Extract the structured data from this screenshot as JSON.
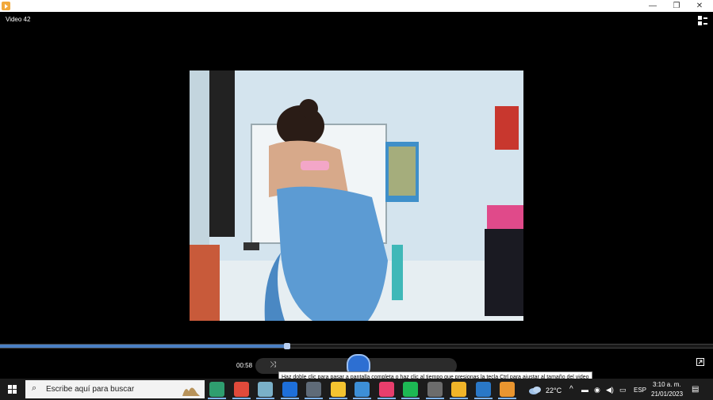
{
  "window": {
    "minimize": "—",
    "restore": "❐",
    "close": "✕"
  },
  "player": {
    "title": "Video 42",
    "current_time": "00:58",
    "progress": 0.403,
    "tooltip": "Haz doble clic para pasar a pantalla completa o haz clic al tiempo que presionas la tecla Ctrl para ajustar al tamaño del video"
  },
  "taskbar": {
    "search_placeholder": "Escribe aquí para buscar",
    "apps": [
      {
        "name": "edge-icon",
        "color": "#2f9e6f"
      },
      {
        "name": "chrome-icon",
        "color": "#e04a3b"
      },
      {
        "name": "notepad-icon",
        "color": "#7ab0c8"
      },
      {
        "name": "teamviewer-icon",
        "color": "#1e6fd9"
      },
      {
        "name": "camera-icon",
        "color": "#5f6b78"
      },
      {
        "name": "files-icon",
        "color": "#f4c430"
      },
      {
        "name": "photos-icon",
        "color": "#3d8fd6"
      },
      {
        "name": "app-pink-icon",
        "color": "#e83e6c"
      },
      {
        "name": "spotify-icon",
        "color": "#1db954"
      },
      {
        "name": "webcam-icon",
        "color": "#6c6c6c"
      },
      {
        "name": "file-explorer-icon",
        "color": "#f0b429"
      },
      {
        "name": "image-editor-icon",
        "color": "#2a78c7"
      },
      {
        "name": "media-player-icon",
        "color": "#e9952f"
      }
    ],
    "weather": "22°C",
    "language": "ESP",
    "time": "3:10 a. m.",
    "date": "21/01/2023"
  }
}
